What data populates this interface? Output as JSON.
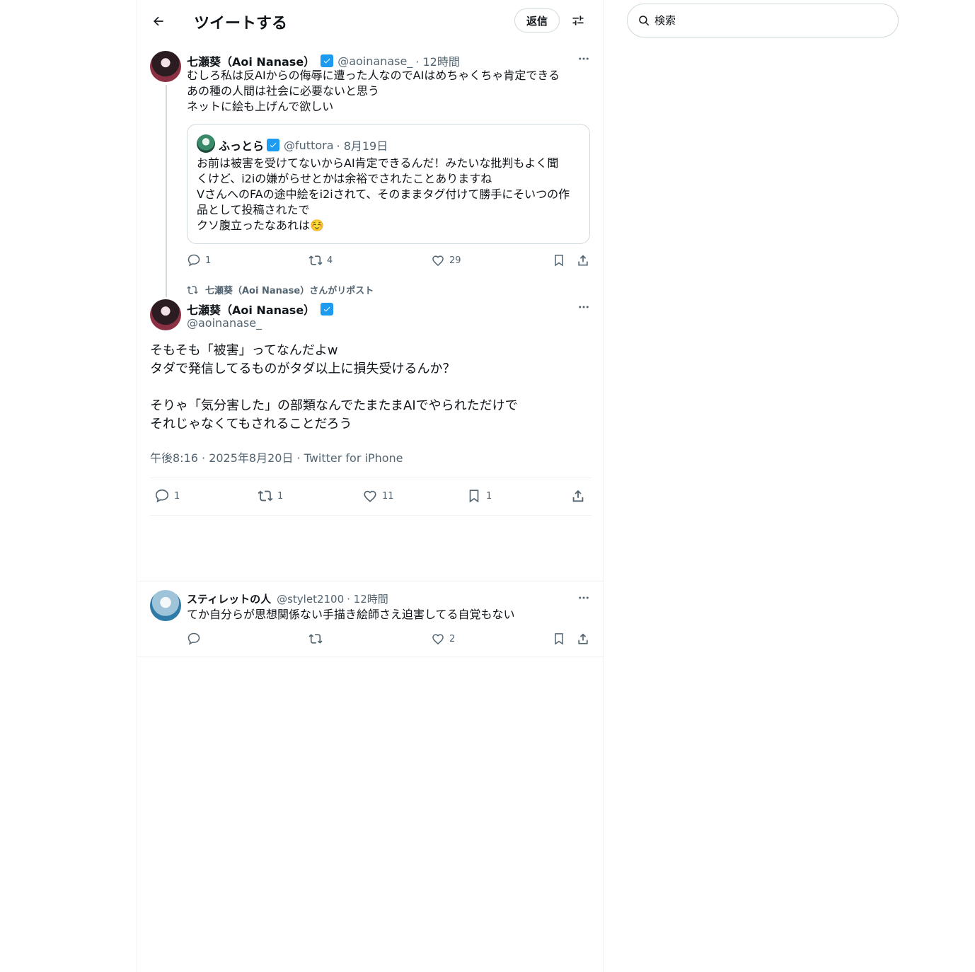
{
  "header": {
    "title": "ツイートする",
    "reply_button": "返信"
  },
  "search": {
    "placeholder": "検索"
  },
  "parent_tweet": {
    "name": "七瀬葵（Aoi Nanase）",
    "handle": "@aoinanase_",
    "time": "· 12時間",
    "text": "むしろ私は反AIからの侮辱に遭った人なのでAIはめちゃくちゃ肯定できる\nあの種の人間は社会に必要ないと思う\nネットに絵も上げんで欲しい",
    "quote": {
      "name": "ふっとら",
      "handle": "@futtora",
      "time": "· 8月19日",
      "text": "お前は被害を受けてないからAI肯定できるんだ！みたいな批判もよく聞\nくけど、i2iの嫌がらせとかは余裕でされたことありますね\nVさんへのFAの途中絵をi2iされて、そのままタグ付けて勝手にそいつの作\n品として投稿されたで\nクソ腹立ったなあれは☺️"
    },
    "stats": {
      "replies": "1",
      "reposts": "4",
      "likes": "29"
    }
  },
  "repost_label": "七瀬葵（Aoi Nanase）さんがリポスト",
  "main_tweet": {
    "name": "七瀬葵（Aoi Nanase）",
    "handle": "@aoinanase_",
    "text": "そもそも「被害」ってなんだよw\nタダで発信してるものがタダ以上に損失受けるんか？\n\nそりゃ「気分害した」の部類なんでたまたまAIでやられただけで\nそれじゃなくてもされることだろう",
    "meta": "午後8:16 · 2025年8月20日 · Twitter for iPhone",
    "stats": {
      "replies": "1",
      "reposts": "1",
      "likes": "11",
      "bookmarks": "1"
    }
  },
  "reply_tweet": {
    "name": "スティレットの人",
    "handle": "@stylet2100",
    "time": "· 12時間",
    "text": "てか自分らが思想関係ない手描き絵師さえ迫害してる自覚もない",
    "stats": {
      "likes": "2"
    }
  },
  "icons": [
    "back-arrow-icon",
    "tune-icon",
    "search-icon",
    "verified-icon",
    "more-icon",
    "reply-icon",
    "repost-icon",
    "like-icon",
    "bookmark-icon",
    "share-icon"
  ]
}
